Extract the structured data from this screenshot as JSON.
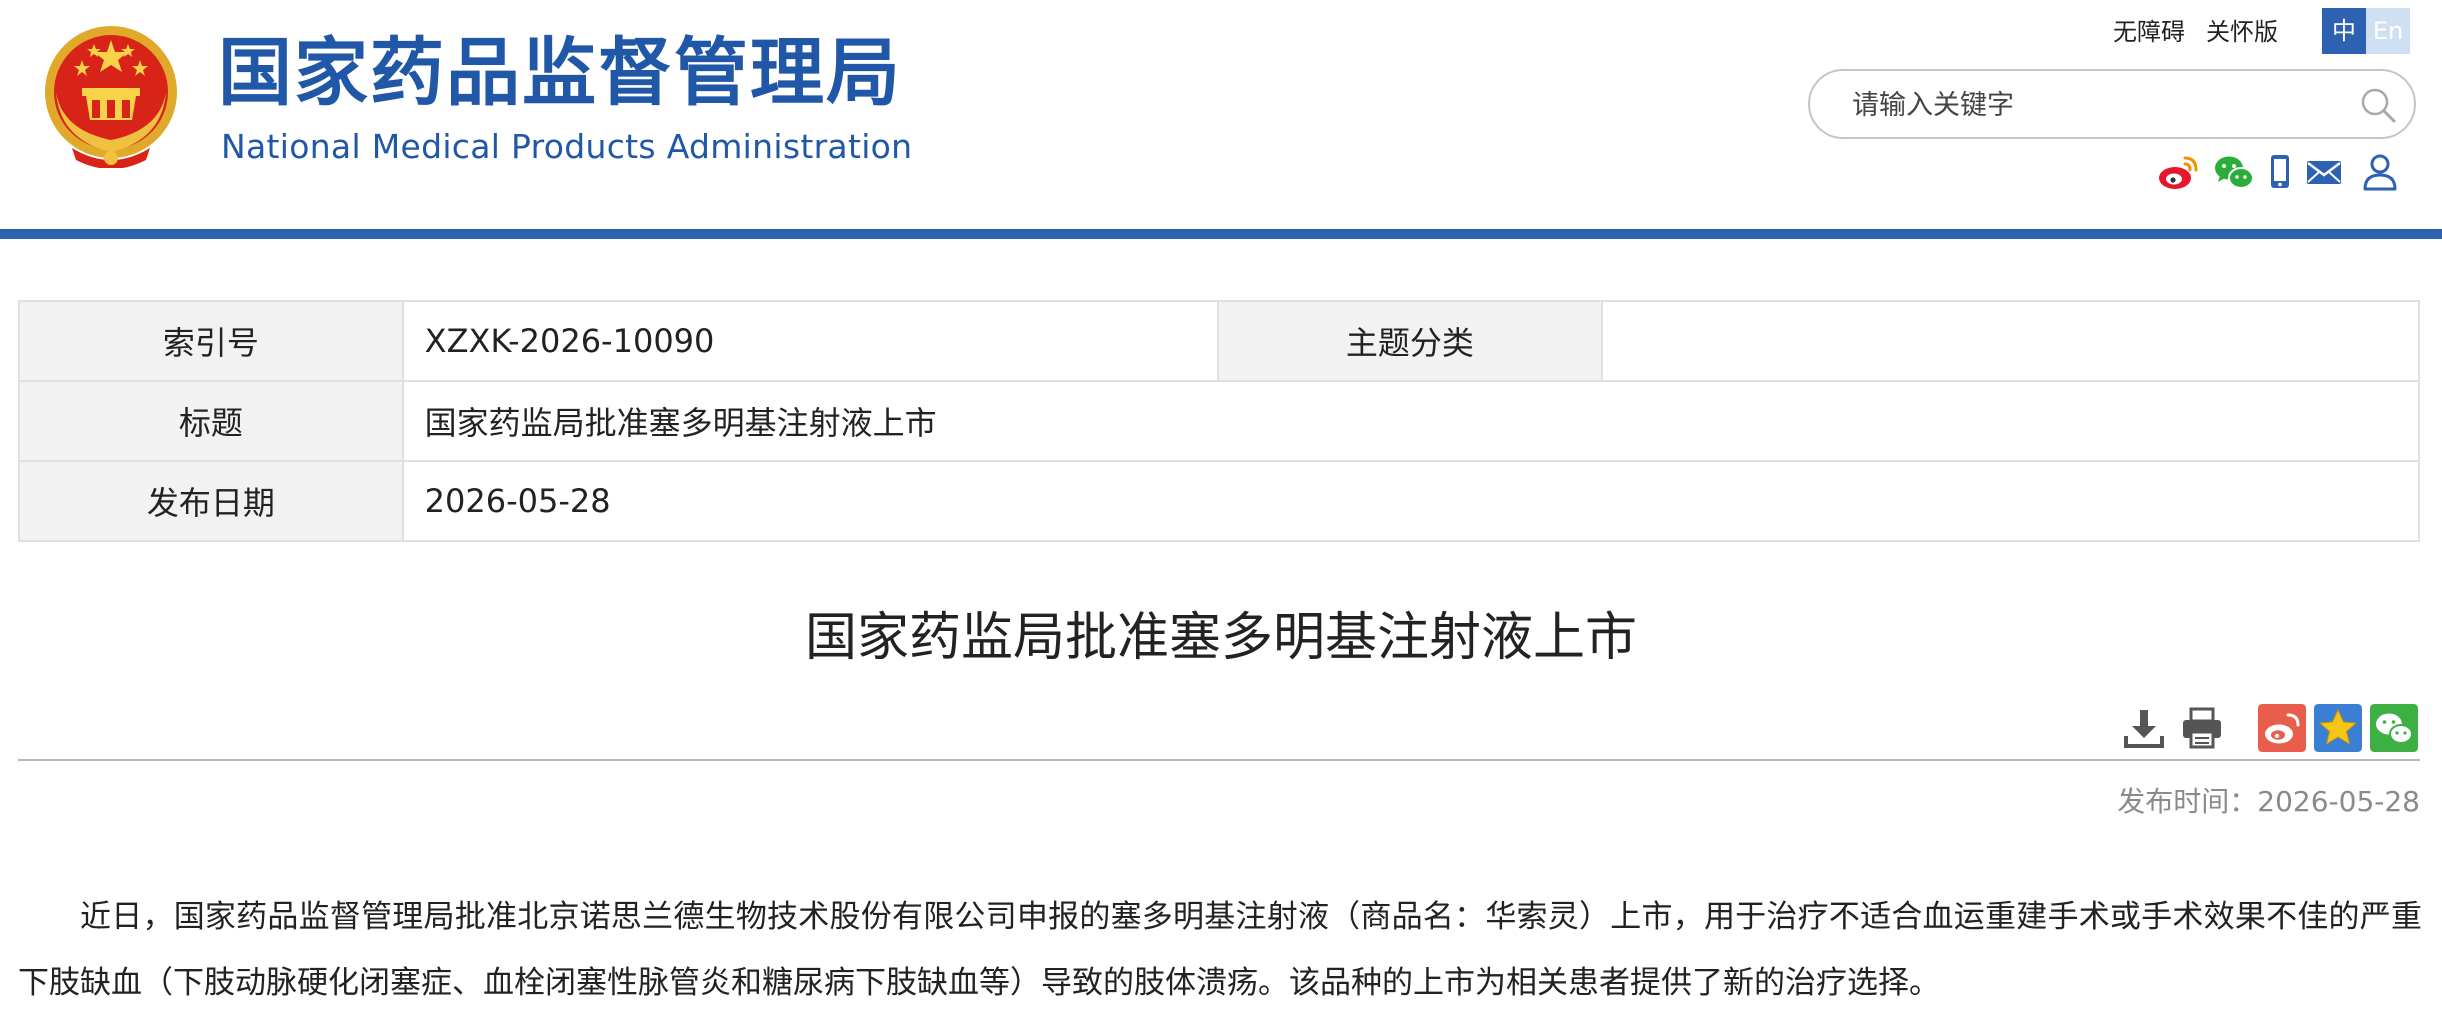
{
  "header": {
    "title_cn": "国家药品监督管理局",
    "title_en": "National Medical Products Administration",
    "top_links": [
      "无障碍",
      "关怀版"
    ],
    "lang_zh": "中",
    "lang_en": "En",
    "search_placeholder": "请输入关键字",
    "social_icons": [
      "weibo-icon",
      "wechat-icon",
      "mobile-icon",
      "mail-icon",
      "user-icon"
    ],
    "brand_color": "#2d62b3"
  },
  "info": {
    "index_label": "索引号",
    "index_value": "XZXK-2026-10090",
    "topic_label": "主题分类",
    "topic_value": "",
    "title_label": "标题",
    "title_value": "国家药监局批准塞多明基注射液上市",
    "date_label": "发布日期",
    "date_value": "2026-05-28"
  },
  "article": {
    "title": "国家药监局批准塞多明基注射液上市",
    "publish_time": "发布时间：2026-05-28",
    "body": "近日，国家药品监督管理局批准北京诺思兰德生物技术股份有限公司申报的塞多明基注射液（商品名：华索灵）上市，用于治疗不适合血运重建手术或手术效果不佳的严重下肢缺血（下肢动脉硬化闭塞症、血栓闭塞性脉管炎和糖尿病下肢缺血等）导致的肢体溃疡。该品种的上市为相关患者提供了新的治疗选择。",
    "tools": [
      "download-icon",
      "print-icon"
    ],
    "share": [
      "weibo-share-icon",
      "favorite-share-icon",
      "wechat-share-icon"
    ]
  }
}
